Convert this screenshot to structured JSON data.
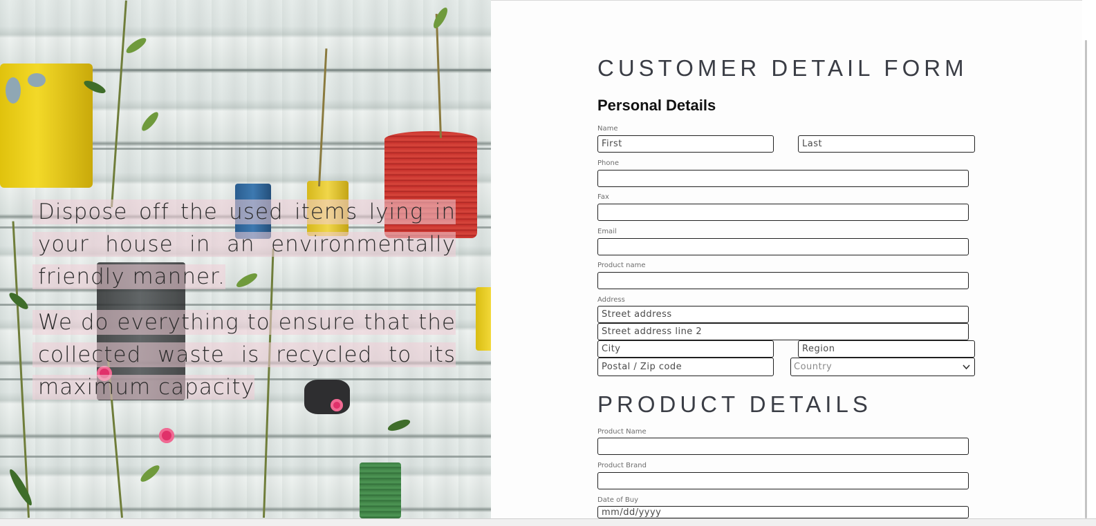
{
  "hero": {
    "paragraph_1": "Dispose off the used items lying in your house in an environmentally friendly manner.",
    "paragraph_2": "We do everything to ensure that the collected waste is recycled to its maximum capacity"
  },
  "form": {
    "title": "CUSTOMER DETAIL FORM",
    "personal_heading": "Personal Details",
    "name_label": "Name",
    "first_placeholder": "First",
    "last_placeholder": "Last",
    "phone_label": "Phone",
    "fax_label": "Fax",
    "email_label": "Email",
    "product_name_label": "Product name",
    "address_label": "Address",
    "street_placeholder": "Street address",
    "street2_placeholder": "Street address line 2",
    "city_placeholder": "City",
    "region_placeholder": "Region",
    "postal_placeholder": "Postal / Zip code",
    "country_selected": "Country",
    "product_heading": "PRODUCT DETAILS",
    "product_name2_label": "Product Name",
    "product_brand_label": "Product Brand",
    "date_of_buy_label": "Date of Buy",
    "date_placeholder": "mm/dd/yyyy"
  },
  "icons": {
    "dropdown": "chevron-down-icon"
  }
}
